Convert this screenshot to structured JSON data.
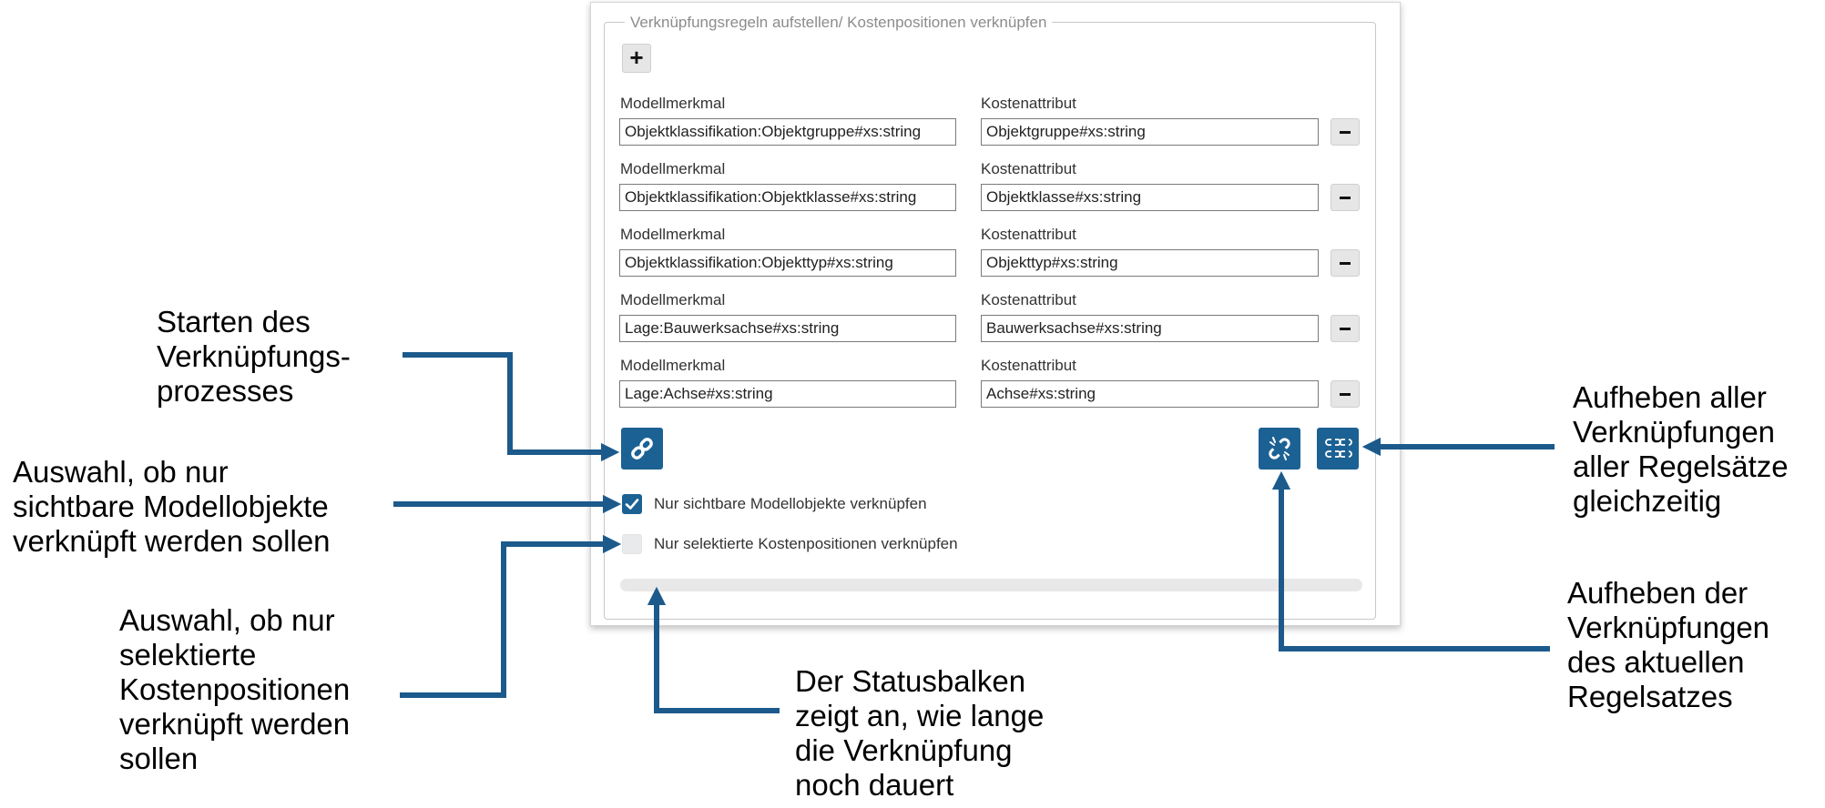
{
  "panel": {
    "legend": "Verknüpfungsregeln aufstellen/ Kostenpositionen verknüpfen",
    "add_label": "+",
    "rules": [
      {
        "model_label": "Modellmerkmal",
        "model_value": "Objektklassifikation:Objektgruppe#xs:string",
        "cost_label": "Kostenattribut",
        "cost_value": "Objektgruppe#xs:string"
      },
      {
        "model_label": "Modellmerkmal",
        "model_value": "Objektklassifikation:Objektklasse#xs:string",
        "cost_label": "Kostenattribut",
        "cost_value": "Objektklasse#xs:string"
      },
      {
        "model_label": "Modellmerkmal",
        "model_value": "Objektklassifikation:Objekttyp#xs:string",
        "cost_label": "Kostenattribut",
        "cost_value": "Objekttyp#xs:string"
      },
      {
        "model_label": "Modellmerkmal",
        "model_value": "Lage:Bauwerksachse#xs:string",
        "cost_label": "Kostenattribut",
        "cost_value": "Bauwerksachse#xs:string"
      },
      {
        "model_label": "Modellmerkmal",
        "model_value": "Lage:Achse#xs:string",
        "cost_label": "Kostenattribut",
        "cost_value": "Achse#xs:string"
      }
    ],
    "buttons": {
      "link": "link-icon",
      "unlink_current": "broken-link-icon",
      "unlink_all": "broken-links-multiple-icon"
    },
    "checkboxes": [
      {
        "label": "Nur sichtbare Modellobjekte verknüpfen",
        "checked": true
      },
      {
        "label": "Nur selektierte Kostenpositionen verknüpfen",
        "checked": false
      }
    ],
    "progress": 0,
    "accent_color": "#1c6193"
  },
  "annotations": {
    "start": [
      "Starten des",
      "Verknüpfungs-",
      "prozesses"
    ],
    "visible": [
      "Auswahl, ob nur",
      "sichtbare Modellobjekte",
      "verknüpft werden sollen"
    ],
    "selected": [
      "Auswahl, ob nur",
      "selektierte",
      "Kostenpositionen",
      "verknüpft werden",
      "sollen"
    ],
    "status": [
      "Der Statusbalken",
      "zeigt an, wie lange",
      "die Verknüpfung",
      "noch dauert"
    ],
    "unlink_all": [
      "Aufheben aller",
      "Verknüpfungen",
      "aller Regelsätze",
      "gleichzeitig"
    ],
    "unlink_current": [
      "Aufheben der",
      "Verknüpfungen",
      "des aktuellen",
      "Regelsatzes"
    ]
  }
}
